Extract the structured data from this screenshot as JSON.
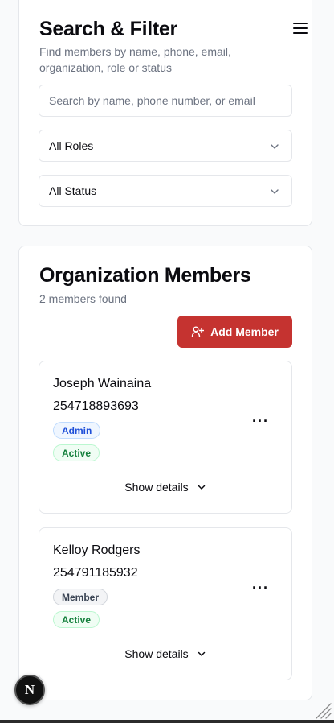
{
  "filter": {
    "title": "Search & Filter",
    "subtitle": "Find members by name, phone, email, organization, role or status",
    "search_placeholder": "Search by name, phone number, or email",
    "role_select": "All Roles",
    "status_select": "All Status"
  },
  "members": {
    "title": "Organization Members",
    "count_text": "2 members found",
    "add_button": "Add Member",
    "list": [
      {
        "name": "Joseph Wainaina",
        "phone": "254718893693",
        "role": "Admin",
        "status": "Active",
        "details": "Show details",
        "more": "···"
      },
      {
        "name": "Kelloy Rodgers",
        "phone": "254791185932",
        "role": "Member",
        "status": "Active",
        "details": "Show details",
        "more": "···"
      }
    ]
  },
  "dev_badge": {
    "letter": "N"
  },
  "colors": {
    "accent": "#c53330",
    "admin_badge": "#1d4ed8",
    "active_badge": "#15803d",
    "muted_text": "#6b7280"
  },
  "icons": [
    "menu-icon",
    "chevron-down-icon",
    "user-plus-icon",
    "more-horizontal-icon",
    "resize-grip-icon"
  ]
}
